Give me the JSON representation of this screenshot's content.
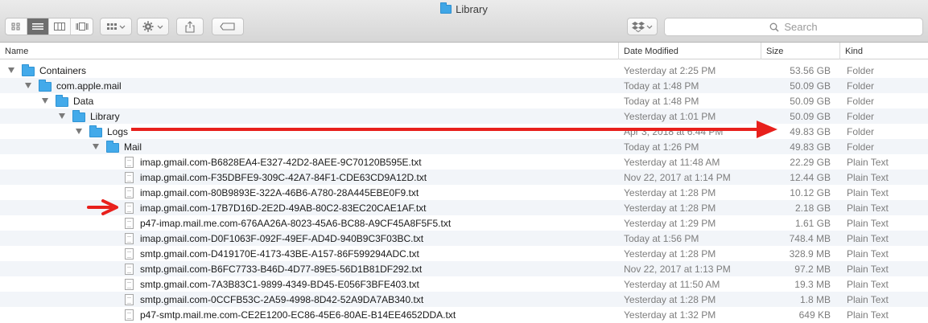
{
  "window": {
    "title": "Library",
    "search_placeholder": "Search"
  },
  "toolbar": {
    "view_modes": [
      "icon-view",
      "list-view",
      "column-view",
      "cover-flow-view"
    ],
    "active_view": "list-view"
  },
  "columns": {
    "name": "Name",
    "date": "Date Modified",
    "size": "Size",
    "kind": "Kind"
  },
  "rows": [
    {
      "name": "Containers",
      "date": "Yesterday at 2:25 PM",
      "size": "53.56 GB",
      "kind": "Folder",
      "type": "folder",
      "level": 0,
      "expanded": true
    },
    {
      "name": "com.apple.mail",
      "date": "Today at 1:48 PM",
      "size": "50.09 GB",
      "kind": "Folder",
      "type": "folder",
      "level": 1,
      "expanded": true
    },
    {
      "name": "Data",
      "date": "Today at 1:48 PM",
      "size": "50.09 GB",
      "kind": "Folder",
      "type": "folder",
      "level": 2,
      "expanded": true
    },
    {
      "name": "Library",
      "date": "Yesterday at 1:01 PM",
      "size": "50.09 GB",
      "kind": "Folder",
      "type": "folder",
      "level": 3,
      "expanded": true
    },
    {
      "name": "Logs",
      "date": "Apr 3, 2018 at 6:44 PM",
      "size": "49.83 GB",
      "kind": "Folder",
      "type": "folder",
      "level": 4,
      "expanded": true
    },
    {
      "name": "Mail",
      "date": "Today at 1:26 PM",
      "size": "49.83 GB",
      "kind": "Folder",
      "type": "folder",
      "level": 5,
      "expanded": true
    },
    {
      "name": "imap.gmail.com-B6828EA4-E327-42D2-8AEE-9C70120B595E.txt",
      "date": "Yesterday at 11:48 AM",
      "size": "22.29 GB",
      "kind": "Plain Text",
      "type": "file",
      "level": 6
    },
    {
      "name": "imap.gmail.com-F35DBFE9-309C-42A7-84F1-CDE63CD9A12D.txt",
      "date": "Nov 22, 2017 at 1:14 PM",
      "size": "12.44 GB",
      "kind": "Plain Text",
      "type": "file",
      "level": 6
    },
    {
      "name": "imap.gmail.com-80B9893E-322A-46B6-A780-28A445EBE0F9.txt",
      "date": "Yesterday at 1:28 PM",
      "size": "10.12 GB",
      "kind": "Plain Text",
      "type": "file",
      "level": 6
    },
    {
      "name": "imap.gmail.com-17B7D16D-2E2D-49AB-80C2-83EC20CAE1AF.txt",
      "date": "Yesterday at 1:28 PM",
      "size": "2.18 GB",
      "kind": "Plain Text",
      "type": "file",
      "level": 6
    },
    {
      "name": "p47-imap.mail.me.com-676AA26A-8023-45A6-BC88-A9CF45A8F5F5.txt",
      "date": "Yesterday at 1:29 PM",
      "size": "1.61 GB",
      "kind": "Plain Text",
      "type": "file",
      "level": 6
    },
    {
      "name": "imap.gmail.com-D0F1063F-092F-49EF-AD4D-940B9C3F03BC.txt",
      "date": "Today at 1:56 PM",
      "size": "748.4 MB",
      "kind": "Plain Text",
      "type": "file",
      "level": 6
    },
    {
      "name": "smtp.gmail.com-D419170E-4173-43BE-A157-86F599294ADC.txt",
      "date": "Yesterday at 1:28 PM",
      "size": "328.9 MB",
      "kind": "Plain Text",
      "type": "file",
      "level": 6
    },
    {
      "name": "smtp.gmail.com-B6FC7733-B46D-4D77-89E5-56D1B81DF292.txt",
      "date": "Nov 22, 2017 at 1:13 PM",
      "size": "97.2 MB",
      "kind": "Plain Text",
      "type": "file",
      "level": 6
    },
    {
      "name": "smtp.gmail.com-7A3B83C1-9899-4349-BD45-E056F3BFE403.txt",
      "date": "Yesterday at 11:50 AM",
      "size": "19.3 MB",
      "kind": "Plain Text",
      "type": "file",
      "level": 6
    },
    {
      "name": "smtp.gmail.com-0CCFB53C-2A59-4998-8D42-52A9DA7AB340.txt",
      "date": "Yesterday at 1:28 PM",
      "size": "1.8 MB",
      "kind": "Plain Text",
      "type": "file",
      "level": 6
    },
    {
      "name": "p47-smtp.mail.me.com-CE2E1200-EC86-45E6-80AE-B14EE4652DDA.txt",
      "date": "Yesterday at 1:32 PM",
      "size": "649 KB",
      "kind": "Plain Text",
      "type": "file",
      "level": 6
    }
  ],
  "annotation_color": "#e8201c"
}
